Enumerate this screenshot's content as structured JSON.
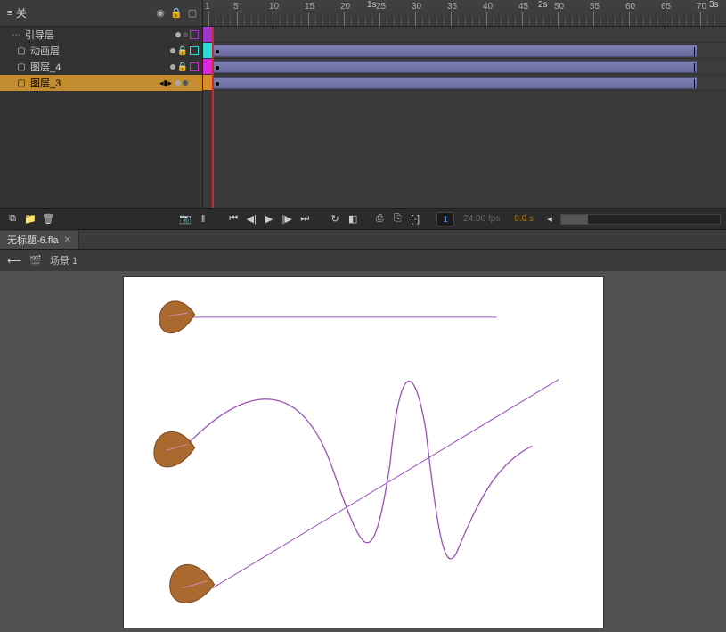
{
  "timeline": {
    "header_title": "关",
    "header_icons": {
      "eye": "◉",
      "lock": "🔒",
      "outline": "▢"
    },
    "ruler": {
      "seconds": [
        "1s",
        "2s",
        "3s"
      ],
      "majors": [
        1,
        5,
        10,
        15,
        20,
        25,
        30,
        35,
        40,
        45,
        50,
        55,
        60,
        65,
        70
      ]
    },
    "layers": [
      {
        "name": "引导层",
        "type": "guide",
        "visible": true,
        "locked": false,
        "outline": "#a135c9"
      },
      {
        "name": "动画层",
        "type": "normal",
        "visible": true,
        "locked": true,
        "outline": "#2dd9d9",
        "tween": true
      },
      {
        "name": "图层_4",
        "type": "normal",
        "visible": true,
        "locked": true,
        "outline": "#d927d9",
        "tween": true
      },
      {
        "name": "图层_3",
        "type": "normal",
        "visible": true,
        "locked": false,
        "outline": "#d98c27",
        "tween": true,
        "selected": true
      }
    ],
    "play_controls": {
      "goto_first": "⏮",
      "step_back": "◀|",
      "play": "▶",
      "step_fwd": "|▶",
      "goto_last": "⏭",
      "loop": "↻",
      "onion": "◧",
      "frame1": "⎙",
      "frame2": "⎘",
      "marker": "[·]"
    },
    "status": {
      "frame": "1",
      "fps": "24.00 fps",
      "time": "0.0 s"
    }
  },
  "doc": {
    "tab": "无标题-6.fla",
    "scene": "场景 1",
    "back_arrow": "⟵",
    "scene_icon": "🎬"
  },
  "bottom_tools": {
    "new_layer": "⧉",
    "new_folder": "📁",
    "trash": "🗑"
  },
  "left_tools": {
    "camera": "📷",
    "divider": "‖"
  }
}
